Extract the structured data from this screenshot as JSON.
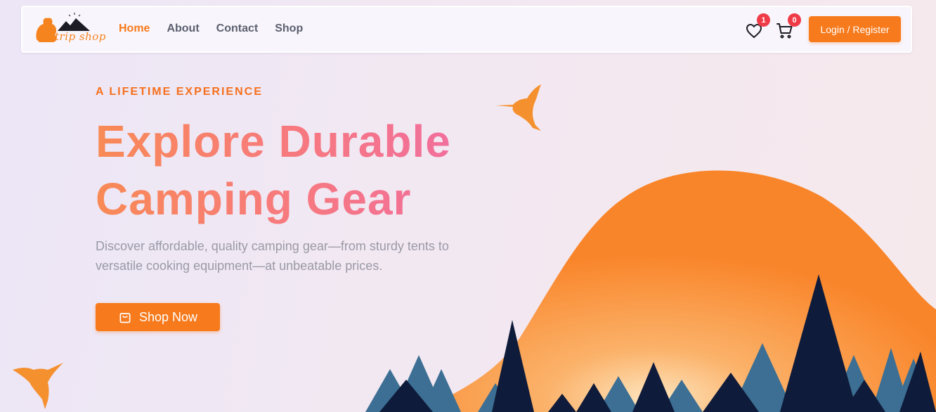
{
  "brand": {
    "logo_text": "trip shop"
  },
  "nav": {
    "links": [
      {
        "label": "Home",
        "active": true
      },
      {
        "label": "About",
        "active": false
      },
      {
        "label": "Contact",
        "active": false
      },
      {
        "label": "Shop",
        "active": false
      }
    ],
    "wishlist_count": "1",
    "cart_count": "0",
    "login_label": "Login / Register"
  },
  "hero": {
    "eyebrow": "A LIFETIME EXPERIENCE",
    "headline_line1": "Explore Durable",
    "headline_line2": "Camping Gear",
    "description": "Discover affordable, quality camping gear—from sturdy tents to versatile cooking equipment—at unbeatable prices.",
    "cta_label": "Shop Now"
  },
  "icons": {
    "wishlist": "heart-icon",
    "cart": "cart-icon",
    "cta": "shopping-bag-icon",
    "decor": [
      "hummingbird-icon",
      "hummingbird-icon"
    ]
  },
  "colors": {
    "accent": "#f77a1c",
    "badge": "#ef3b48",
    "mountain": "#f98a2c",
    "trees_dark": "#0f1b3a",
    "trees_blue": "#3c6f93"
  }
}
